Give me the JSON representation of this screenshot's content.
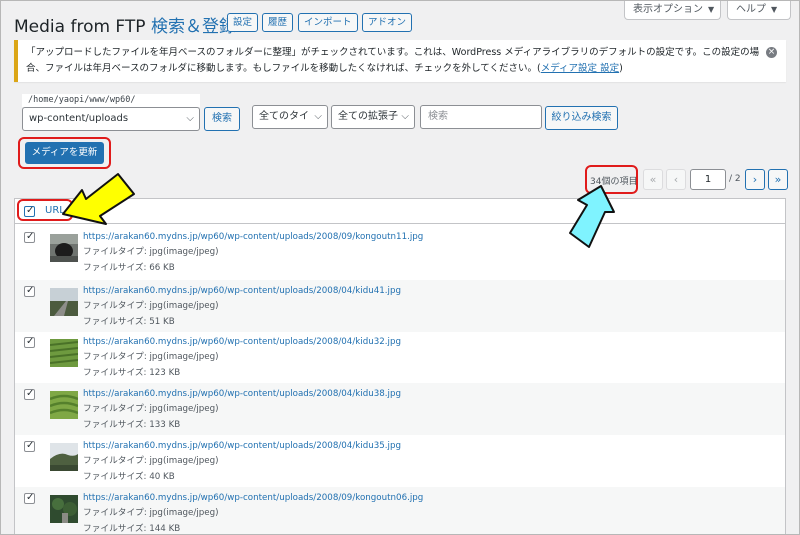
{
  "header": {
    "title_main": "Media from FTP",
    "title_accent": "検索＆登録",
    "tabs": [
      "設定",
      "履歴",
      "インポート",
      "アドオン"
    ],
    "screen_options": "表示オプション",
    "help": "ヘルプ"
  },
  "notice": {
    "text": "「アップロードしたファイルを年月ベースのフォルダーに整理」がチェックされています。これは、WordPress メディアライブラリのデフォルトの設定です。この設定の場合、ファイルは年月ベースのフォルダに移動します。もしファイルを移動したくなければ、チェックを外してください。(",
    "link": "メディア設定 設定",
    "tail": ")"
  },
  "filters": {
    "path_label": "/home/yaopi/www/wp60/",
    "dir_select": "wp-content/uploads",
    "search_button": "検索",
    "type_select": "全てのタイ",
    "ext_select": "全ての拡張子",
    "search_placeholder": "検索",
    "filter_button": "絞り込み検索"
  },
  "actions": {
    "update_button": "メディアを更新"
  },
  "pagination": {
    "count": "34個の項目",
    "first": "«",
    "prev": "‹",
    "current": "1",
    "total": "/ 2",
    "next": "›",
    "last": "»"
  },
  "table": {
    "column_header": "URL",
    "rows": [
      {
        "url": "https://arakan60.mydns.jp/wp60/wp-content/uploads/2008/09/kongoutn11.jpg",
        "type": "ファイルタイプ: jpg(image/jpeg)",
        "size": "ファイルサイズ: 66 KB",
        "thumb": "tunnel"
      },
      {
        "url": "https://arakan60.mydns.jp/wp60/wp-content/uploads/2008/04/kidu41.jpg",
        "type": "ファイルタイプ: jpg(image/jpeg)",
        "size": "ファイルサイズ: 51 KB",
        "thumb": "road"
      },
      {
        "url": "https://arakan60.mydns.jp/wp60/wp-content/uploads/2008/04/kidu32.jpg",
        "type": "ファイルタイプ: jpg(image/jpeg)",
        "size": "ファイルサイズ: 123 KB",
        "thumb": "field"
      },
      {
        "url": "https://arakan60.mydns.jp/wp60/wp-content/uploads/2008/04/kidu38.jpg",
        "type": "ファイルタイプ: jpg(image/jpeg)",
        "size": "ファイルサイズ: 133 KB",
        "thumb": "tea"
      },
      {
        "url": "https://arakan60.mydns.jp/wp60/wp-content/uploads/2008/04/kidu35.jpg",
        "type": "ファイルタイプ: jpg(image/jpeg)",
        "size": "ファイルサイズ: 40 KB",
        "thumb": "hill"
      },
      {
        "url": "https://arakan60.mydns.jp/wp60/wp-content/uploads/2008/09/kongoutn06.jpg",
        "type": "ファイルタイプ: jpg(image/jpeg)",
        "size": "ファイルサイズ: 144 KB",
        "thumb": "forest"
      }
    ]
  },
  "colors": {
    "accent": "#2271b1",
    "highlight": "#e01b1b",
    "arrow_yellow": "#ffff00",
    "arrow_cyan": "#7ff3ff",
    "notice_border": "#dba617"
  }
}
